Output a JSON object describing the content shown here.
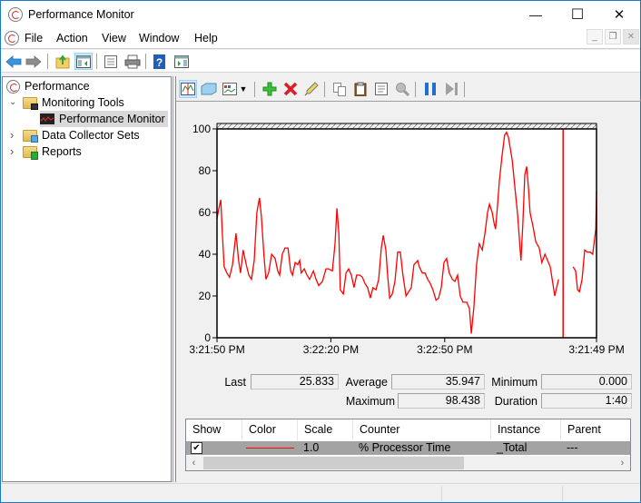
{
  "window": {
    "title": "Performance Monitor",
    "controls": {
      "minimize": "—",
      "maximize": "☐",
      "close": "✕"
    }
  },
  "menu": {
    "items": [
      "File",
      "Action",
      "View",
      "Window",
      "Help"
    ],
    "mdi_controls": {
      "minimize": "_",
      "restore": "❐",
      "close": "✕"
    }
  },
  "toolbar": {
    "buttons": [
      {
        "name": "back",
        "icon": "back-arrow-icon"
      },
      {
        "name": "forward",
        "icon": "forward-arrow-icon"
      },
      {
        "name": "up-level",
        "icon": "folder-up-icon"
      },
      {
        "name": "show-hide-console-tree",
        "icon": "console-tree-icon",
        "active": true
      },
      {
        "name": "properties",
        "icon": "properties-icon"
      },
      {
        "name": "print",
        "icon": "printer-icon"
      },
      {
        "name": "help",
        "icon": "help-icon"
      },
      {
        "name": "show-hide-action-pane",
        "icon": "action-pane-icon"
      }
    ]
  },
  "tree": {
    "items": [
      {
        "label": "Performance",
        "level": 0,
        "expander": "",
        "icon": "performance-icon"
      },
      {
        "label": "Monitoring Tools",
        "level": 1,
        "expander": "expanded",
        "icon": "folder-icon"
      },
      {
        "label": "Performance Monitor",
        "level": 2,
        "expander": "",
        "icon": "perfmon-chart-icon",
        "selected": true
      },
      {
        "label": "Data Collector Sets",
        "level": 1,
        "expander": "collapsed",
        "icon": "folder-icon"
      },
      {
        "label": "Reports",
        "level": 1,
        "expander": "collapsed",
        "icon": "folder-icon"
      }
    ]
  },
  "perf_toolbar": {
    "buttons": [
      {
        "name": "view-current-activity",
        "icon": "line-graph-icon",
        "active": true
      },
      {
        "name": "view-log-data",
        "icon": "log-data-icon"
      },
      {
        "name": "change-graph-type",
        "icon": "graph-type-icon"
      },
      {
        "name": "graph-type-dropdown",
        "icon": "dropdown-arrow-icon"
      },
      {
        "name": "add-counter",
        "icon": "plus-icon"
      },
      {
        "name": "delete-counter",
        "icon": "delete-x-icon"
      },
      {
        "name": "highlight",
        "icon": "highlighter-icon"
      },
      {
        "name": "copy-properties",
        "icon": "copy-icon"
      },
      {
        "name": "paste-counter-list",
        "icon": "paste-icon"
      },
      {
        "name": "properties",
        "icon": "properties-icon"
      },
      {
        "name": "zoom",
        "icon": "magnifier-icon"
      },
      {
        "name": "freeze-display",
        "icon": "pause-icon"
      },
      {
        "name": "update-data",
        "icon": "step-forward-icon"
      }
    ]
  },
  "chart_data": {
    "type": "line",
    "title": "",
    "xlabel": "",
    "ylabel": "",
    "ylim": [
      0,
      100
    ],
    "yticks": [
      0,
      20,
      40,
      60,
      80,
      100
    ],
    "xtick_labels": [
      "3:21:50 PM",
      "3:22:20 PM",
      "3:22:50 PM",
      "3:21:49 PM"
    ],
    "xlim_seconds": [
      0,
      100
    ],
    "xtick_positions_seconds": [
      0,
      30,
      60,
      100
    ],
    "cursor_seconds": 91.2,
    "grid": false,
    "series": [
      {
        "name": "% Processor Time",
        "color": "#ff0000",
        "points": [
          [
            0.0,
            57
          ],
          [
            0.5,
            62
          ],
          [
            1.0,
            66
          ],
          [
            1.4,
            50
          ],
          [
            1.9,
            34
          ],
          [
            2.6,
            31
          ],
          [
            3.3,
            29
          ],
          [
            4.1,
            35
          ],
          [
            5.0,
            50
          ],
          [
            5.7,
            37
          ],
          [
            6.2,
            31
          ],
          [
            6.9,
            42
          ],
          [
            7.7,
            35
          ],
          [
            8.4,
            30
          ],
          [
            9.1,
            28
          ],
          [
            9.8,
            37
          ],
          [
            10.5,
            60
          ],
          [
            11.2,
            67
          ],
          [
            11.7,
            58
          ],
          [
            12.4,
            39
          ],
          [
            12.9,
            28
          ],
          [
            13.6,
            31
          ],
          [
            14.4,
            40
          ],
          [
            15.3,
            38
          ],
          [
            16.0,
            32
          ],
          [
            16.5,
            30
          ],
          [
            17.2,
            40
          ],
          [
            17.9,
            43
          ],
          [
            18.7,
            43
          ],
          [
            19.4,
            32
          ],
          [
            19.9,
            30
          ],
          [
            20.6,
            36
          ],
          [
            21.3,
            35
          ],
          [
            21.8,
            37
          ],
          [
            22.2,
            31
          ],
          [
            23.0,
            33
          ],
          [
            23.7,
            30
          ],
          [
            24.4,
            28
          ],
          [
            25.4,
            32
          ],
          [
            26.1,
            28
          ],
          [
            26.8,
            25
          ],
          [
            27.8,
            27
          ],
          [
            28.7,
            33
          ],
          [
            29.4,
            33
          ],
          [
            30.4,
            32
          ],
          [
            31.1,
            45
          ],
          [
            31.6,
            62
          ],
          [
            32.1,
            50
          ],
          [
            32.5,
            23
          ],
          [
            33.3,
            21
          ],
          [
            34.0,
            31
          ],
          [
            34.7,
            33
          ],
          [
            35.4,
            30
          ],
          [
            36.1,
            24
          ],
          [
            36.8,
            30
          ],
          [
            37.6,
            30
          ],
          [
            38.3,
            29
          ],
          [
            39.0,
            26
          ],
          [
            39.7,
            24
          ],
          [
            40.4,
            19
          ],
          [
            41.1,
            24
          ],
          [
            41.9,
            23
          ],
          [
            42.6,
            28
          ],
          [
            43.3,
            43
          ],
          [
            43.8,
            49
          ],
          [
            44.5,
            42
          ],
          [
            45.0,
            29
          ],
          [
            45.5,
            19
          ],
          [
            46.2,
            21
          ],
          [
            46.9,
            27
          ],
          [
            47.6,
            41
          ],
          [
            48.3,
            41
          ],
          [
            49.0,
            30
          ],
          [
            49.8,
            20
          ],
          [
            50.5,
            22
          ],
          [
            51.2,
            24
          ],
          [
            51.9,
            35
          ],
          [
            52.9,
            37
          ],
          [
            53.3,
            34
          ],
          [
            54.1,
            31
          ],
          [
            54.8,
            31
          ],
          [
            55.5,
            28
          ],
          [
            56.2,
            26
          ],
          [
            56.9,
            23
          ],
          [
            57.7,
            18
          ],
          [
            58.4,
            19
          ],
          [
            59.1,
            24
          ],
          [
            59.8,
            36
          ],
          [
            60.5,
            38
          ],
          [
            61.2,
            31
          ],
          [
            62.0,
            28
          ],
          [
            62.7,
            27
          ],
          [
            63.4,
            30
          ],
          [
            64.1,
            20
          ],
          [
            64.8,
            17
          ],
          [
            65.8,
            17
          ],
          [
            66.5,
            14
          ],
          [
            67.0,
            2
          ],
          [
            67.7,
            15
          ],
          [
            68.4,
            35
          ],
          [
            69.1,
            45
          ],
          [
            69.9,
            42
          ],
          [
            70.6,
            50
          ],
          [
            71.3,
            60
          ],
          [
            71.8,
            64
          ],
          [
            72.5,
            60
          ],
          [
            73.0,
            55
          ],
          [
            73.4,
            52
          ],
          [
            73.9,
            63
          ],
          [
            74.4,
            75
          ],
          [
            75.1,
            87
          ],
          [
            75.8,
            97
          ],
          [
            76.3,
            98.4
          ],
          [
            76.8,
            96
          ],
          [
            77.8,
            85
          ],
          [
            78.5,
            72
          ],
          [
            79.2,
            59
          ],
          [
            79.7,
            47
          ],
          [
            80.1,
            37
          ],
          [
            80.6,
            55
          ],
          [
            81.1,
            78
          ],
          [
            81.6,
            82
          ],
          [
            82.1,
            71
          ],
          [
            82.5,
            60
          ],
          [
            83.3,
            53
          ],
          [
            84.0,
            46
          ],
          [
            84.9,
            43
          ],
          [
            85.6,
            36
          ],
          [
            86.4,
            40
          ],
          [
            87.1,
            37
          ],
          [
            87.8,
            34
          ],
          [
            88.5,
            26
          ],
          [
            89.0,
            20
          ],
          [
            89.5,
            24
          ],
          [
            90.0,
            28
          ]
        ],
        "points_after_gap": [
          [
            93.8,
            34
          ],
          [
            94.5,
            32
          ],
          [
            95.0,
            23
          ],
          [
            95.5,
            22
          ],
          [
            96.2,
            28
          ],
          [
            96.9,
            42
          ],
          [
            97.6,
            41
          ],
          [
            98.3,
            41
          ],
          [
            99.0,
            40
          ],
          [
            99.8,
            52
          ],
          [
            100.0,
            70
          ]
        ]
      }
    ]
  },
  "stats": {
    "last_label": "Last",
    "last_value": "25.833",
    "average_label": "Average",
    "average_value": "35.947",
    "minimum_label": "Minimum",
    "minimum_value": "0.000",
    "maximum_label": "Maximum",
    "maximum_value": "98.438",
    "duration_label": "Duration",
    "duration_value": "1:40"
  },
  "legend_table": {
    "columns": [
      "Show",
      "Color",
      "Scale",
      "Counter",
      "Instance",
      "Parent"
    ],
    "rows": [
      {
        "show": true,
        "show_glyph": "✔",
        "color": "#ff0000",
        "scale": "1.0",
        "counter": "% Processor Time",
        "instance": "_Total",
        "parent": "---"
      }
    ],
    "scroll_left": "‹",
    "scroll_right": "›"
  }
}
